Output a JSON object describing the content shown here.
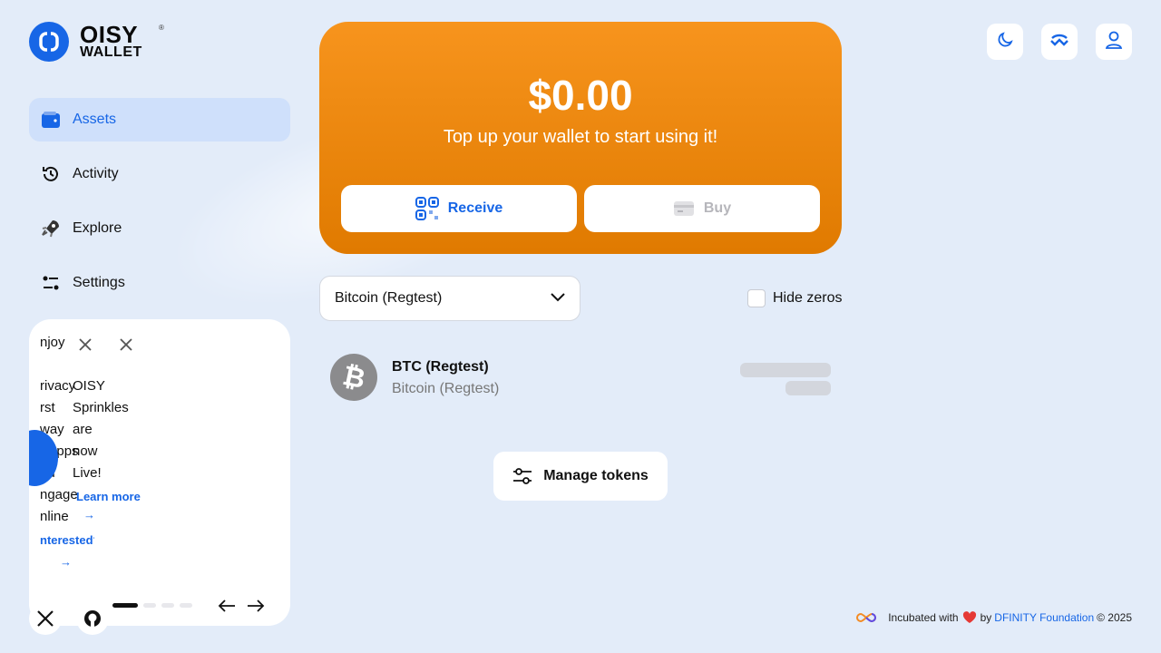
{
  "brand": {
    "line1": "OISY",
    "line2": "WALLET",
    "reg": "®"
  },
  "nav": {
    "items": [
      {
        "label": "Assets"
      },
      {
        "label": "Activity"
      },
      {
        "label": "Explore"
      },
      {
        "label": "Settings"
      }
    ]
  },
  "info_card": {
    "slide_a_lines": [
      "njoy",
      "rivacy",
      "rst",
      "way",
      "dApps",
      "nd",
      "ngage",
      "nline"
    ],
    "slide_a_link": "nterested?",
    "slide_b_lines": [
      "OISY",
      "Sprinkles",
      "are",
      "now",
      "Live!"
    ],
    "slide_b_link": "Learn more",
    "close_label": "×",
    "arrow_glyph": "→",
    "page_count": 4,
    "current_page": 1
  },
  "hero": {
    "balance": "$0.00",
    "subtitle": "Top up your wallet to start using it!",
    "receive_label": "Receive",
    "buy_label": "Buy"
  },
  "filters": {
    "network_selected": "Bitcoin (Regtest)",
    "hide_zeros_label": "Hide zeros",
    "hide_zeros_checked": false
  },
  "tokens": [
    {
      "symbol": "BTC (Regtest)",
      "network": "Bitcoin (Regtest)"
    }
  ],
  "manage_tokens_label": "Manage tokens",
  "footer": {
    "incubated": "Incubated with",
    "by": "by",
    "org": "DFINITY Foundation",
    "copyright": "© 2025"
  },
  "colors": {
    "accent": "#1766e6",
    "hero_top": "#f7941d",
    "hero_bottom": "#e07a00",
    "background": "#e3ecf9"
  }
}
